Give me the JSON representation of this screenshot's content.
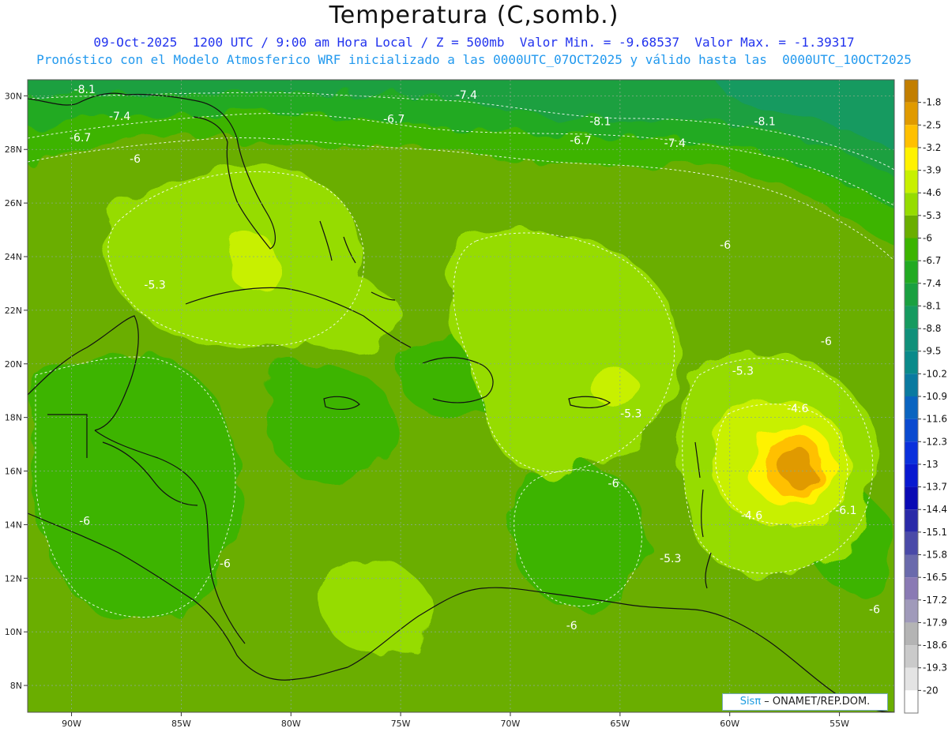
{
  "header": {
    "title": "Temperatura (C,somb.)",
    "line1": "09-Oct-2025  1200 UTC / 9:00 am Hora Local / Z = 500mb  Valor Min. = -9.68537  Valor Max. = -1.39317",
    "line2": "Pronóstico con el Modelo Atmosferico WRF inicializado a las 0000UTC_07OCT2025 y válido hasta las  0000UTC_10OCT2025"
  },
  "map": {
    "lon_range": [
      -92,
      -52.5
    ],
    "lat_range": [
      7,
      30.6
    ],
    "lon_ticks": [
      {
        "lon": -90,
        "label": "90W"
      },
      {
        "lon": -85,
        "label": "85W"
      },
      {
        "lon": -80,
        "label": "80W"
      },
      {
        "lon": -75,
        "label": "75W"
      },
      {
        "lon": -70,
        "label": "70W"
      },
      {
        "lon": -65,
        "label": "65W"
      },
      {
        "lon": -60,
        "label": "60W"
      },
      {
        "lon": -55,
        "label": "55W"
      }
    ],
    "lat_ticks": [
      {
        "lat": 8,
        "label": "8N"
      },
      {
        "lat": 10,
        "label": "10N"
      },
      {
        "lat": 12,
        "label": "12N"
      },
      {
        "lat": 14,
        "label": "14N"
      },
      {
        "lat": 16,
        "label": "16N"
      },
      {
        "lat": 18,
        "label": "18N"
      },
      {
        "lat": 20,
        "label": "20N"
      },
      {
        "lat": 22,
        "label": "22N"
      },
      {
        "lat": 24,
        "label": "24N"
      },
      {
        "lat": 26,
        "label": "26N"
      },
      {
        "lat": 28,
        "label": "28N"
      },
      {
        "lat": 30,
        "label": "30N"
      }
    ],
    "contour_labels": [
      {
        "text": "-8.1",
        "lon": -89.4,
        "lat": 30.1
      },
      {
        "text": "-7.4",
        "lon": -87.8,
        "lat": 29.1
      },
      {
        "text": "-6.7",
        "lon": -89.6,
        "lat": 28.3
      },
      {
        "text": "-6",
        "lon": -87.1,
        "lat": 27.5
      },
      {
        "text": "-7.4",
        "lon": -72.0,
        "lat": 29.9
      },
      {
        "text": "-6.7",
        "lon": -75.3,
        "lat": 29.0
      },
      {
        "text": "-8.1",
        "lon": -65.9,
        "lat": 28.9
      },
      {
        "text": "-6.7",
        "lon": -66.8,
        "lat": 28.2
      },
      {
        "text": "-7.4",
        "lon": -62.5,
        "lat": 28.1
      },
      {
        "text": "-8.1",
        "lon": -58.4,
        "lat": 28.9
      },
      {
        "text": "-6",
        "lon": -60.2,
        "lat": 24.3
      },
      {
        "text": "-5.3",
        "lon": -86.2,
        "lat": 22.8
      },
      {
        "text": "-6",
        "lon": -55.6,
        "lat": 20.7
      },
      {
        "text": "-5.3",
        "lon": -59.4,
        "lat": 19.6
      },
      {
        "text": "-4.6",
        "lon": -56.9,
        "lat": 18.2
      },
      {
        "text": "-5.3",
        "lon": -64.5,
        "lat": 18.0
      },
      {
        "text": "-6",
        "lon": -65.3,
        "lat": 15.4
      },
      {
        "text": "-4.6",
        "lon": -59.0,
        "lat": 14.2
      },
      {
        "text": "-6.1",
        "lon": -54.7,
        "lat": 14.4
      },
      {
        "text": "-6",
        "lon": -89.4,
        "lat": 14.0
      },
      {
        "text": "-5.3",
        "lon": -62.7,
        "lat": 12.6
      },
      {
        "text": "-6",
        "lon": -83.0,
        "lat": 12.4
      },
      {
        "text": "-6",
        "lon": -67.2,
        "lat": 10.1
      },
      {
        "text": "-6",
        "lon": -53.4,
        "lat": 10.7
      }
    ]
  },
  "colorbar": {
    "labels": [
      "-1.8",
      "-2.5",
      "-3.2",
      "-3.9",
      "-4.6",
      "-5.3",
      "-6",
      "-6.7",
      "-7.4",
      "-8.1",
      "-8.8",
      "-9.5",
      "-10.2",
      "-10.9",
      "-11.6",
      "-12.3",
      "-13",
      "-13.7",
      "-14.4",
      "-15.1",
      "-15.8",
      "-16.5",
      "-17.2",
      "-17.9",
      "-18.6",
      "-19.3",
      "-20"
    ],
    "colors": [
      "#c27e00",
      "#e09a00",
      "#ffc000",
      "#fff200",
      "#c8f000",
      "#96dc00",
      "#6aae00",
      "#3cb400",
      "#22aa22",
      "#1aa040",
      "#169a60",
      "#10907a",
      "#0a8a8a",
      "#0a7aa0",
      "#0a64c0",
      "#0a4ad0",
      "#0a30dc",
      "#0818d0",
      "#0a0ab4",
      "#2a2aa8",
      "#4a4aa8",
      "#6a6aac",
      "#8a7ab4",
      "#a09aba",
      "#b4b4b4",
      "#cacaca",
      "#e4e4e4",
      "#ffffff"
    ]
  },
  "credit": {
    "brand": "Sisπ",
    "org": " – ONAMET/REP.DOM."
  }
}
